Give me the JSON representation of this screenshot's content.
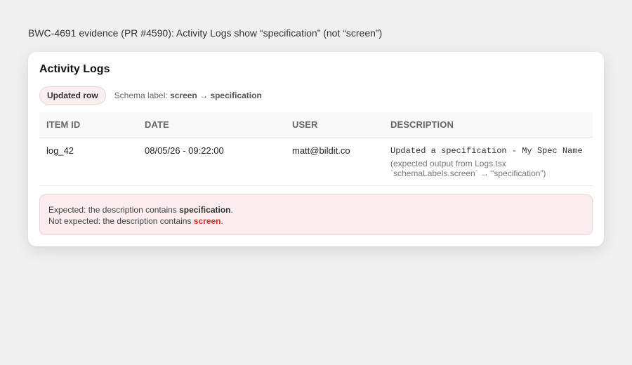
{
  "evidence": {
    "title": "BWC-4691 evidence (PR #4590): Activity Logs show “specification” (not “screen”)"
  },
  "card": {
    "title": "Activity Logs",
    "badge": "Updated row",
    "schema_prefix": "Schema label: ",
    "schema_value": "screen → specification"
  },
  "table": {
    "columns": [
      "ITEM ID",
      "DATE",
      "USER",
      "DESCRIPTION"
    ],
    "rows": [
      {
        "item_id": "log_42",
        "date": "08/05/26 - 09:22:00",
        "user": "matt@bildit.co",
        "description": "Updated a specification - My Spec Name",
        "note_line1": "(expected output from Logs.tsx",
        "note_line2": "`schemaLabels.screen` → “specification”)"
      }
    ]
  },
  "alert": {
    "expected_prefix": "Expected: the description contains ",
    "expected_term": "specification",
    "expected_suffix": ".",
    "not_expected_prefix": "Not expected: the description contains ",
    "not_expected_term": "screen",
    "not_expected_suffix": ".",
    "bad_color": "#d32f2f"
  }
}
